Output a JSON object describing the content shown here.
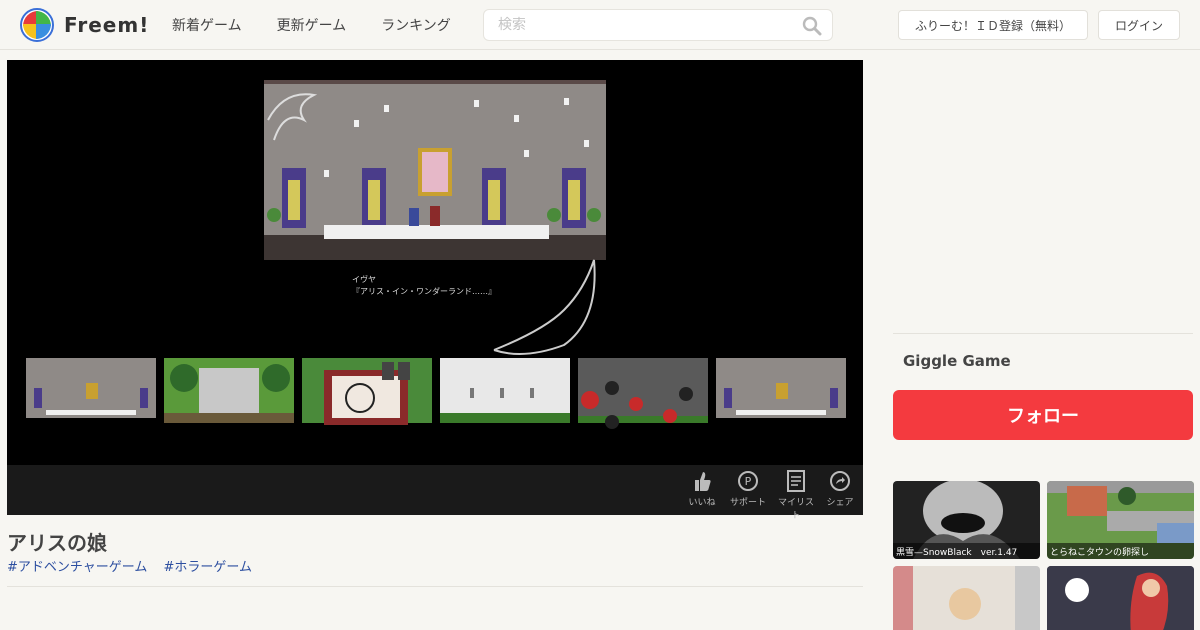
{
  "header": {
    "logo_text": "Freem!",
    "nav": [
      "新着ゲーム",
      "更新ゲーム",
      "ランキング"
    ],
    "search_placeholder": "検索",
    "register_label": "ふりーむ！ＩＤ登録（無料）",
    "login_label": "ログイン"
  },
  "player": {
    "dialog_speaker": "イヴヤ",
    "dialog_text": "『アリス・イン・ワンダーランド……』",
    "thumb_texts": [
      "",
      "",
      "",
      "",
      "",
      ""
    ],
    "controls": [
      {
        "label": "いいね",
        "icon": "thumbs-up-icon"
      },
      {
        "label": "サポート",
        "icon": "support-coin-icon"
      },
      {
        "label": "マイリスト",
        "icon": "mylist-icon"
      },
      {
        "label": "シェア",
        "icon": "share-icon"
      }
    ]
  },
  "game": {
    "title": "アリスの娘",
    "tags": [
      "#アドベンチャーゲーム",
      "#ホラーゲーム"
    ]
  },
  "sidebar": {
    "author": "Giggle Game",
    "follow_label": "フォロー",
    "cards": [
      {
        "caption": "黒雪—SnowBlack　ver.1.47"
      },
      {
        "caption": "とらねこタウンの卵探し"
      },
      {
        "caption": ""
      },
      {
        "caption": ""
      }
    ]
  },
  "colors": {
    "follow_button": "#f43a3f",
    "tag_link": "#2d4fa0",
    "page_bg": "#f7f6f2"
  }
}
